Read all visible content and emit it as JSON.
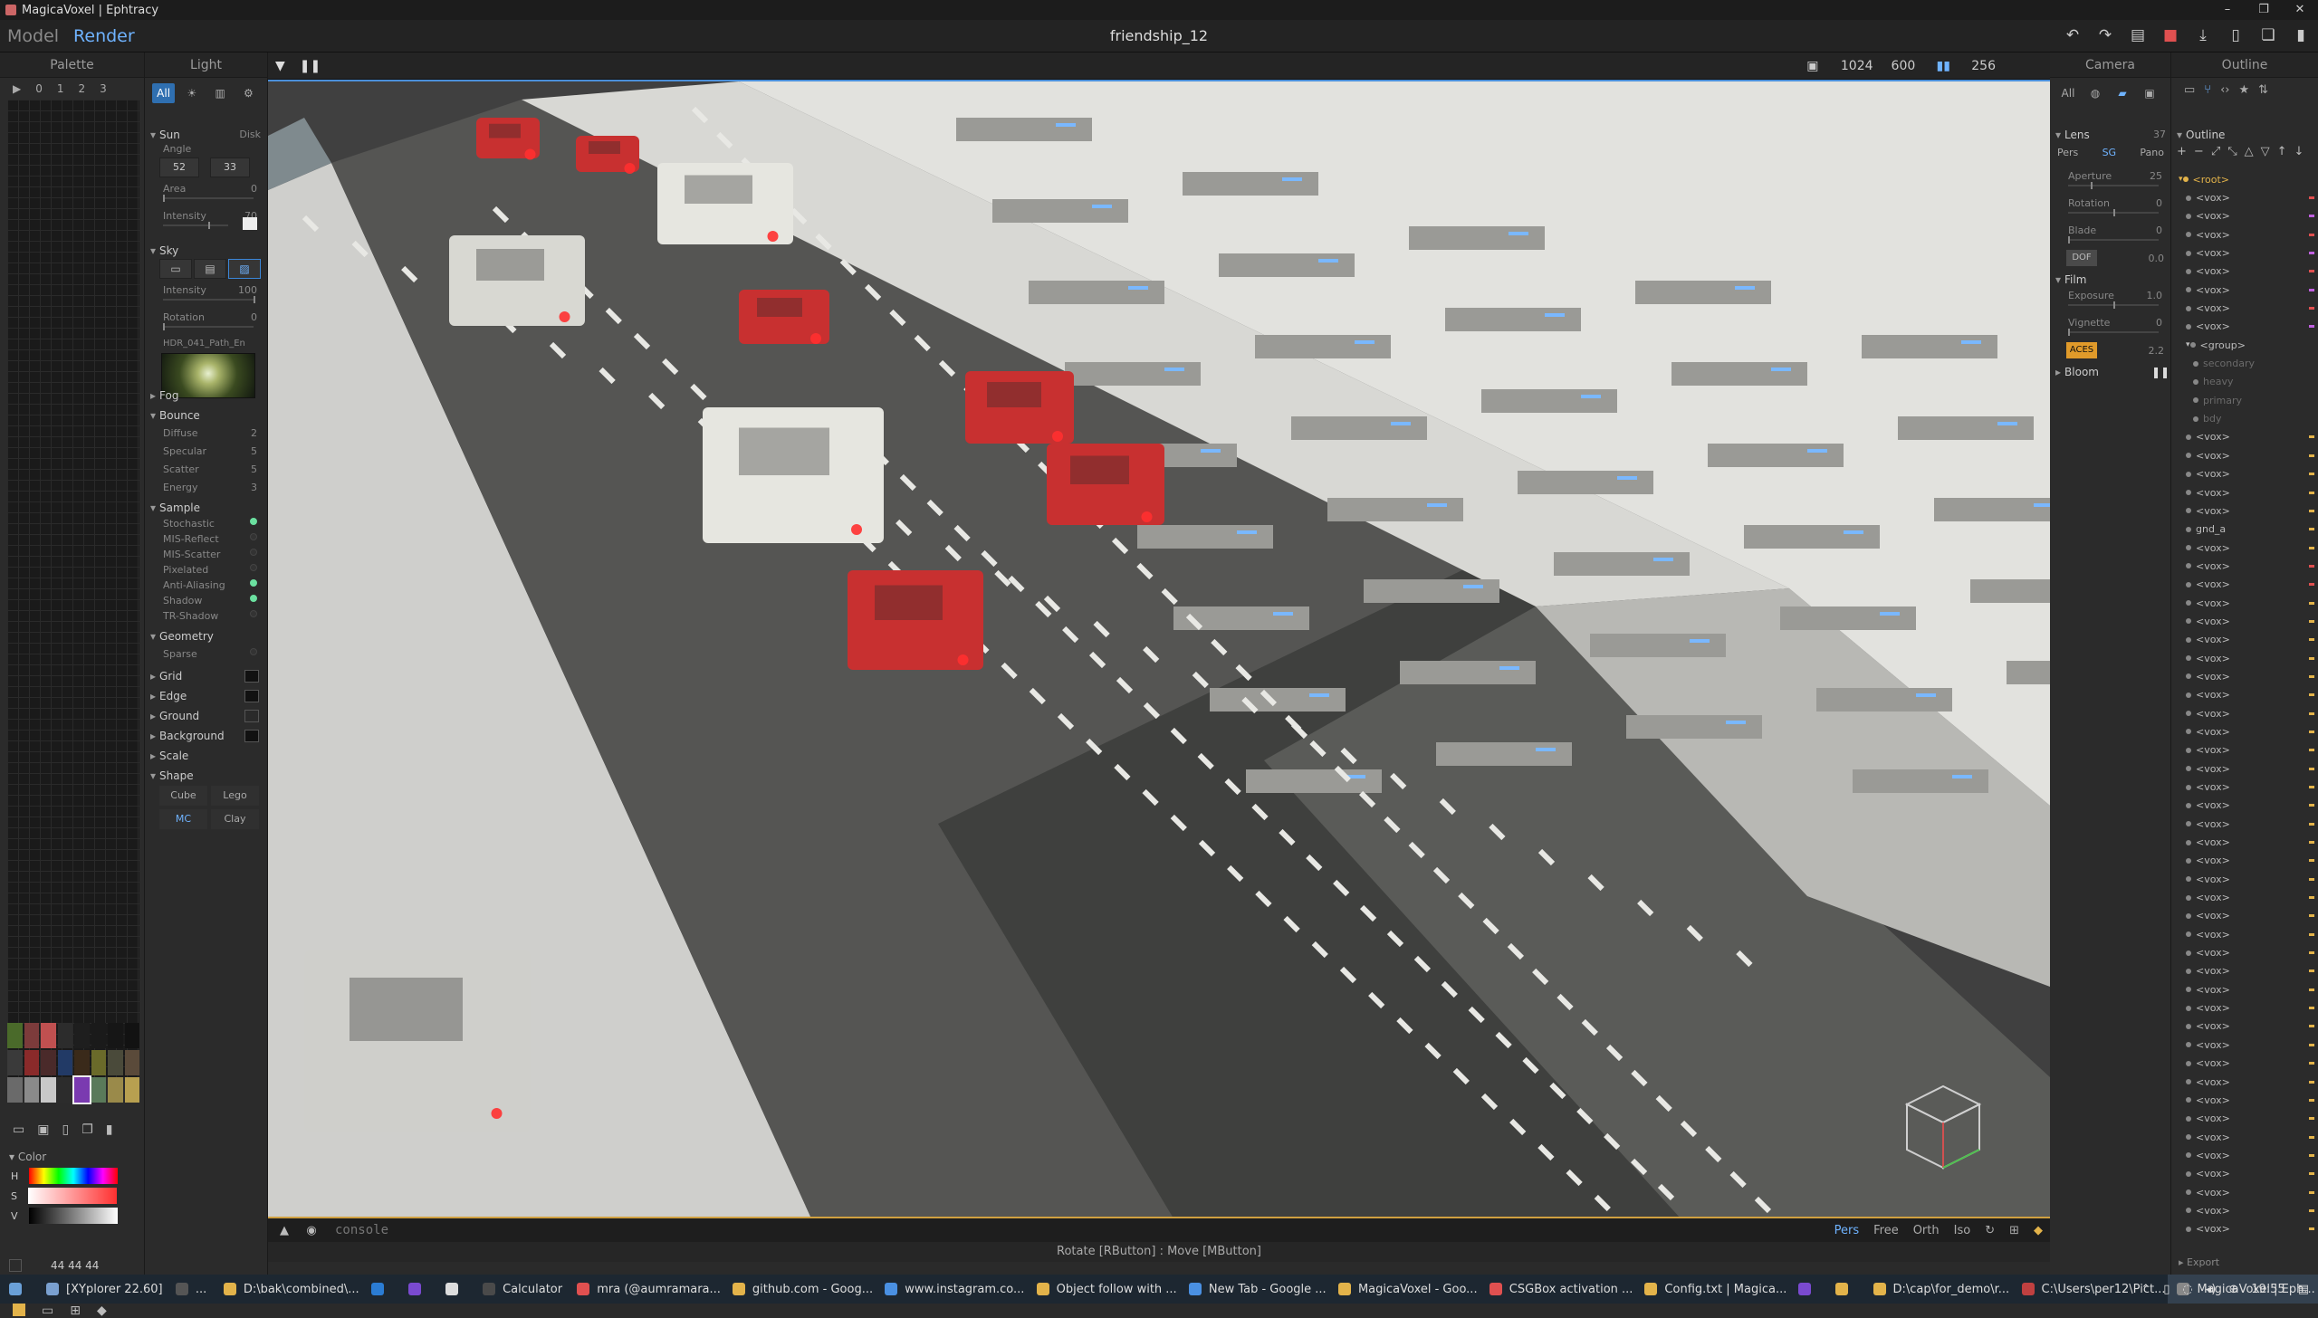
{
  "window": {
    "title": "MagicaVoxel | Ephtracy"
  },
  "menu": {
    "tabs": [
      "Model",
      "Render"
    ],
    "active_tab": "Render",
    "doc_title": "friendship_12"
  },
  "palette": {
    "title": "Palette",
    "tabs": [
      "▶",
      "0",
      "1",
      "2",
      "3"
    ],
    "swatch_colors": [
      "#4a6a2a",
      "#7c3b3b",
      "#c05050",
      "#2c2c2c",
      "#1e1e1e",
      "#1a1a1a",
      "#161616",
      "#121212",
      "#3a3a3a",
      "#8a2a2a",
      "#4a2a2a",
      "#223a66",
      "#3a2a1a",
      "#6a6a2a",
      "#4a4a3a",
      "#5a4a3a",
      "#6a6a6a",
      "#8a8a8a",
      "#c8c8c8",
      "#2c2c2c",
      "#7a3ab0",
      "#5a7a5a",
      "#9a8a4a",
      "#b8a050"
    ],
    "color_title": "Color",
    "hsv_labels": [
      "H",
      "S",
      "V"
    ],
    "rgb_value": "44  44  44"
  },
  "light": {
    "title": "Light",
    "tabs": [
      "All",
      "☀",
      "▥",
      "⚙"
    ],
    "sun": {
      "label": "Sun",
      "mode": "Disk",
      "angle_label": "Angle",
      "angle": [
        "52",
        "33"
      ],
      "area_label": "Area",
      "area": "0",
      "intensity_label": "Intensity",
      "intensity": "70"
    },
    "sky": {
      "label": "Sky",
      "intensity_label": "Intensity",
      "intensity": "100",
      "rotation_label": "Rotation",
      "rotation": "0",
      "hdr_name": "HDR_041_Path_En"
    },
    "fog": {
      "label": "Fog"
    },
    "bounce": {
      "label": "Bounce",
      "diffuse_label": "Diffuse",
      "diffuse": "2",
      "specular_label": "Specular",
      "specular": "5",
      "scatter_label": "Scatter",
      "scatter": "5",
      "energy_label": "Energy",
      "energy": "3"
    },
    "sample": {
      "label": "Sample",
      "items": [
        {
          "label": "Stochastic",
          "on": true
        },
        {
          "label": "MIS-Reflect",
          "on": false
        },
        {
          "label": "MIS-Scatter",
          "on": false
        },
        {
          "label": "Pixelated",
          "on": false
        },
        {
          "label": "Anti-Aliasing",
          "on": true
        },
        {
          "label": "Shadow",
          "on": true
        },
        {
          "label": "TR-Shadow",
          "on": false
        }
      ]
    },
    "geometry": {
      "label": "Geometry",
      "sparse_label": "Sparse"
    },
    "collapsed": [
      {
        "label": "Grid"
      },
      {
        "label": "Edge"
      },
      {
        "label": "Ground"
      },
      {
        "label": "Background"
      },
      {
        "label": "Scale"
      }
    ],
    "shape": {
      "label": "Shape",
      "options": [
        "Cube",
        "Lego",
        "MC",
        "Clay"
      ],
      "active": "MC"
    }
  },
  "viewport": {
    "resolution_w": "1024",
    "resolution_h": "600",
    "samples": "256",
    "console_placeholder": "console",
    "views": [
      "Pers",
      "Free",
      "Orth",
      "Iso"
    ],
    "active_view": "Pers",
    "status": "Rotate [RButton] : Move [MButton]"
  },
  "camera": {
    "title": "Camera",
    "tabs": [
      "All"
    ],
    "lens": {
      "label": "Lens",
      "value": "37",
      "modes": [
        "Pers",
        "SG",
        "Pano"
      ],
      "active_mode": "SG",
      "aperture_label": "Aperture",
      "aperture": "25",
      "rotation_label": "Rotation",
      "rotation": "0",
      "blade_label": "Blade",
      "blade": "0",
      "dof_label": "DOF",
      "dof": "0.0"
    },
    "film": {
      "label": "Film",
      "exposure_label": "Exposure",
      "exposure": "1.0",
      "vignette_label": "Vignette",
      "vignette": "0",
      "aces_label": "ACES",
      "gamma": "2.2"
    },
    "bloom": {
      "label": "Bloom"
    }
  },
  "outline": {
    "title": "Outline",
    "section_label": "Outline",
    "export_label": "Export",
    "items": [
      {
        "label": "<root>",
        "indent": 0,
        "kind": "root"
      },
      {
        "label": "<vox>",
        "indent": 1,
        "mark": "#e05050"
      },
      {
        "label": "<vox>",
        "indent": 1,
        "mark": "#c060e0"
      },
      {
        "label": "<vox>",
        "indent": 1,
        "mark": "#e05050"
      },
      {
        "label": "<vox>",
        "indent": 1,
        "mark": "#c060e0"
      },
      {
        "label": "<vox>",
        "indent": 1,
        "mark": "#e05050"
      },
      {
        "label": "<vox>",
        "indent": 1,
        "mark": "#c060e0"
      },
      {
        "label": "<vox>",
        "indent": 1,
        "mark": "#e05050"
      },
      {
        "label": "<vox>",
        "indent": 1,
        "mark": "#c060e0"
      },
      {
        "label": "<group>",
        "indent": 1
      },
      {
        "label": "secondary",
        "indent": 2,
        "kind": "dim"
      },
      {
        "label": "heavy",
        "indent": 2,
        "kind": "dim"
      },
      {
        "label": "primary",
        "indent": 2,
        "kind": "dim"
      },
      {
        "label": "bdy",
        "indent": 2,
        "kind": "dim"
      },
      {
        "label": "<vox>",
        "indent": 1,
        "mark": "#e3b34a"
      },
      {
        "label": "<vox>",
        "indent": 1,
        "mark": "#e3b34a"
      },
      {
        "label": "<vox>",
        "indent": 1,
        "mark": "#e3b34a"
      },
      {
        "label": "<vox>",
        "indent": 1,
        "mark": "#e3b34a"
      },
      {
        "label": "<vox>",
        "indent": 1,
        "mark": "#e3b34a"
      },
      {
        "label": "gnd_a",
        "indent": 1,
        "mark": "#e3b34a"
      },
      {
        "label": "<vox>",
        "indent": 1,
        "mark": "#e3b34a"
      },
      {
        "label": "<vox>",
        "indent": 1,
        "mark": "#e05050"
      },
      {
        "label": "<vox>",
        "indent": 1,
        "mark": "#e05050"
      },
      {
        "label": "<vox>",
        "indent": 1,
        "mark": "#e3b34a"
      },
      {
        "label": "<vox>",
        "indent": 1,
        "mark": "#e3b34a"
      },
      {
        "label": "<vox>",
        "indent": 1,
        "mark": "#e3b34a"
      },
      {
        "label": "<vox>",
        "indent": 1,
        "mark": "#e3b34a"
      },
      {
        "label": "<vox>",
        "indent": 1,
        "mark": "#e3b34a"
      },
      {
        "label": "<vox>",
        "indent": 1,
        "mark": "#e3b34a"
      },
      {
        "label": "<vox>",
        "indent": 1,
        "mark": "#e3b34a"
      },
      {
        "label": "<vox>",
        "indent": 1,
        "mark": "#e3b34a"
      },
      {
        "label": "<vox>",
        "indent": 1,
        "mark": "#e3b34a"
      },
      {
        "label": "<vox>",
        "indent": 1,
        "mark": "#e3b34a"
      },
      {
        "label": "<vox>",
        "indent": 1,
        "mark": "#e3b34a"
      },
      {
        "label": "<vox>",
        "indent": 1,
        "mark": "#e3b34a"
      },
      {
        "label": "<vox>",
        "indent": 1,
        "mark": "#e3b34a"
      },
      {
        "label": "<vox>",
        "indent": 1,
        "mark": "#e3b34a"
      },
      {
        "label": "<vox>",
        "indent": 1,
        "mark": "#e3b34a"
      },
      {
        "label": "<vox>",
        "indent": 1,
        "mark": "#e3b34a"
      },
      {
        "label": "<vox>",
        "indent": 1,
        "mark": "#e3b34a"
      },
      {
        "label": "<vox>",
        "indent": 1,
        "mark": "#e3b34a"
      },
      {
        "label": "<vox>",
        "indent": 1,
        "mark": "#e3b34a"
      },
      {
        "label": "<vox>",
        "indent": 1,
        "mark": "#e3b34a"
      },
      {
        "label": "<vox>",
        "indent": 1,
        "mark": "#e3b34a"
      },
      {
        "label": "<vox>",
        "indent": 1,
        "mark": "#e3b34a"
      },
      {
        "label": "<vox>",
        "indent": 1,
        "mark": "#e3b34a"
      },
      {
        "label": "<vox>",
        "indent": 1,
        "mark": "#e3b34a"
      },
      {
        "label": "<vox>",
        "indent": 1,
        "mark": "#e3b34a"
      },
      {
        "label": "<vox>",
        "indent": 1,
        "mark": "#e3b34a"
      },
      {
        "label": "<vox>",
        "indent": 1,
        "mark": "#e3b34a"
      },
      {
        "label": "<vox>",
        "indent": 1,
        "mark": "#e3b34a"
      },
      {
        "label": "<vox>",
        "indent": 1,
        "mark": "#e3b34a"
      },
      {
        "label": "<vox>",
        "indent": 1,
        "mark": "#e3b34a"
      },
      {
        "label": "<vox>",
        "indent": 1,
        "mark": "#e3b34a"
      },
      {
        "label": "<vox>",
        "indent": 1,
        "mark": "#e3b34a"
      },
      {
        "label": "<vox>",
        "indent": 1,
        "mark": "#e3b34a"
      },
      {
        "label": "<vox>",
        "indent": 1,
        "mark": "#e3b34a"
      },
      {
        "label": "<vox>",
        "indent": 1,
        "mark": "#e3b34a"
      }
    ]
  },
  "taskbar": {
    "items": [
      "[XYplorer 22.60]",
      "...",
      "D:\\bak\\combined\\...",
      "",
      "",
      "",
      "Calculator",
      "mra (@aumramara...",
      "github.com - Goog...",
      "www.instagram.co...",
      "Object follow with ...",
      "New Tab - Google ...",
      "MagicaVoxel - Goo...",
      "CSGBox activation ...",
      "Config.txt | Magica...",
      "",
      "",
      "D:\\cap\\for_demo\\r...",
      "C:\\Users\\per12\\Pict...",
      "MagicaVoxel | Eph..."
    ],
    "active": "MagicaVoxel | Eph...",
    "icon_colors": [
      "#7aa0d0",
      "#555",
      "#e3b34a",
      "#2b7cd3",
      "#7a4ad0",
      "#ddd",
      "#4a4a4a",
      "#e05050",
      "#e3b34a",
      "#4a90e2",
      "#e3b34a",
      "#4a90e2",
      "#e3b34a",
      "#e05050",
      "#e3b34a",
      "#7a4ad0",
      "#e3b34a",
      "#e3b34a",
      "#c04040",
      "#888"
    ],
    "clock": "19:55"
  }
}
